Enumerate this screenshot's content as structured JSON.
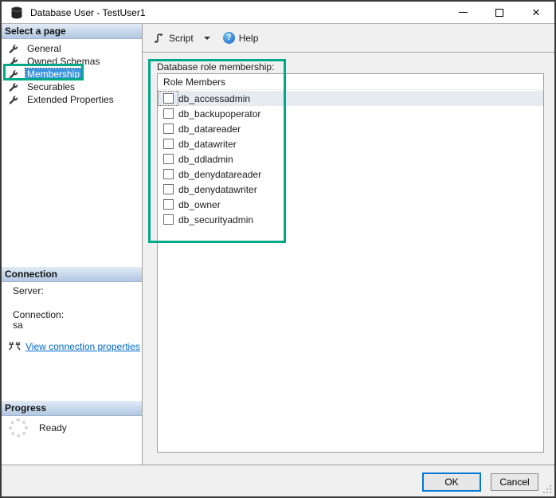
{
  "window": {
    "title": "Database User - TestUser1",
    "controls": {
      "minimize": "minimize",
      "maximize": "maximize",
      "close": "×"
    }
  },
  "toolbar": {
    "script_label": "Script",
    "help_label": "Help"
  },
  "sidebar": {
    "select_page": {
      "header": "Select a page",
      "items": [
        {
          "label": "General",
          "selected": false
        },
        {
          "label": "Owned Schemas",
          "selected": false
        },
        {
          "label": "Membership",
          "selected": true
        },
        {
          "label": "Securables",
          "selected": false
        },
        {
          "label": "Extended Properties",
          "selected": false
        }
      ]
    },
    "connection": {
      "header": "Connection",
      "server_label": "Server:",
      "server_value": "",
      "connection_label": "Connection:",
      "connection_value": "sa",
      "link_label": "View connection properties"
    },
    "progress": {
      "header": "Progress",
      "status": "Ready"
    }
  },
  "main": {
    "role_membership_label": "Database role membership:",
    "list": {
      "column_header": "Role Members",
      "rows": [
        {
          "label": "db_accessadmin",
          "checked": false,
          "selected": true
        },
        {
          "label": "db_backupoperator",
          "checked": false,
          "selected": false
        },
        {
          "label": "db_datareader",
          "checked": false,
          "selected": false
        },
        {
          "label": "db_datawriter",
          "checked": false,
          "selected": false
        },
        {
          "label": "db_ddladmin",
          "checked": false,
          "selected": false
        },
        {
          "label": "db_denydatareader",
          "checked": false,
          "selected": false
        },
        {
          "label": "db_denydatawriter",
          "checked": false,
          "selected": false
        },
        {
          "label": "db_owner",
          "checked": false,
          "selected": false
        },
        {
          "label": "db_securityadmin",
          "checked": false,
          "selected": false
        }
      ]
    }
  },
  "footer": {
    "ok_label": "OK",
    "cancel_label": "Cancel"
  },
  "colors": {
    "annotation_green": "#00a88a",
    "selection_blue": "#3c95e0",
    "row_highlight": "#e6ebf1",
    "default_button_border": "#0078d7",
    "link_blue": "#0066cc"
  }
}
